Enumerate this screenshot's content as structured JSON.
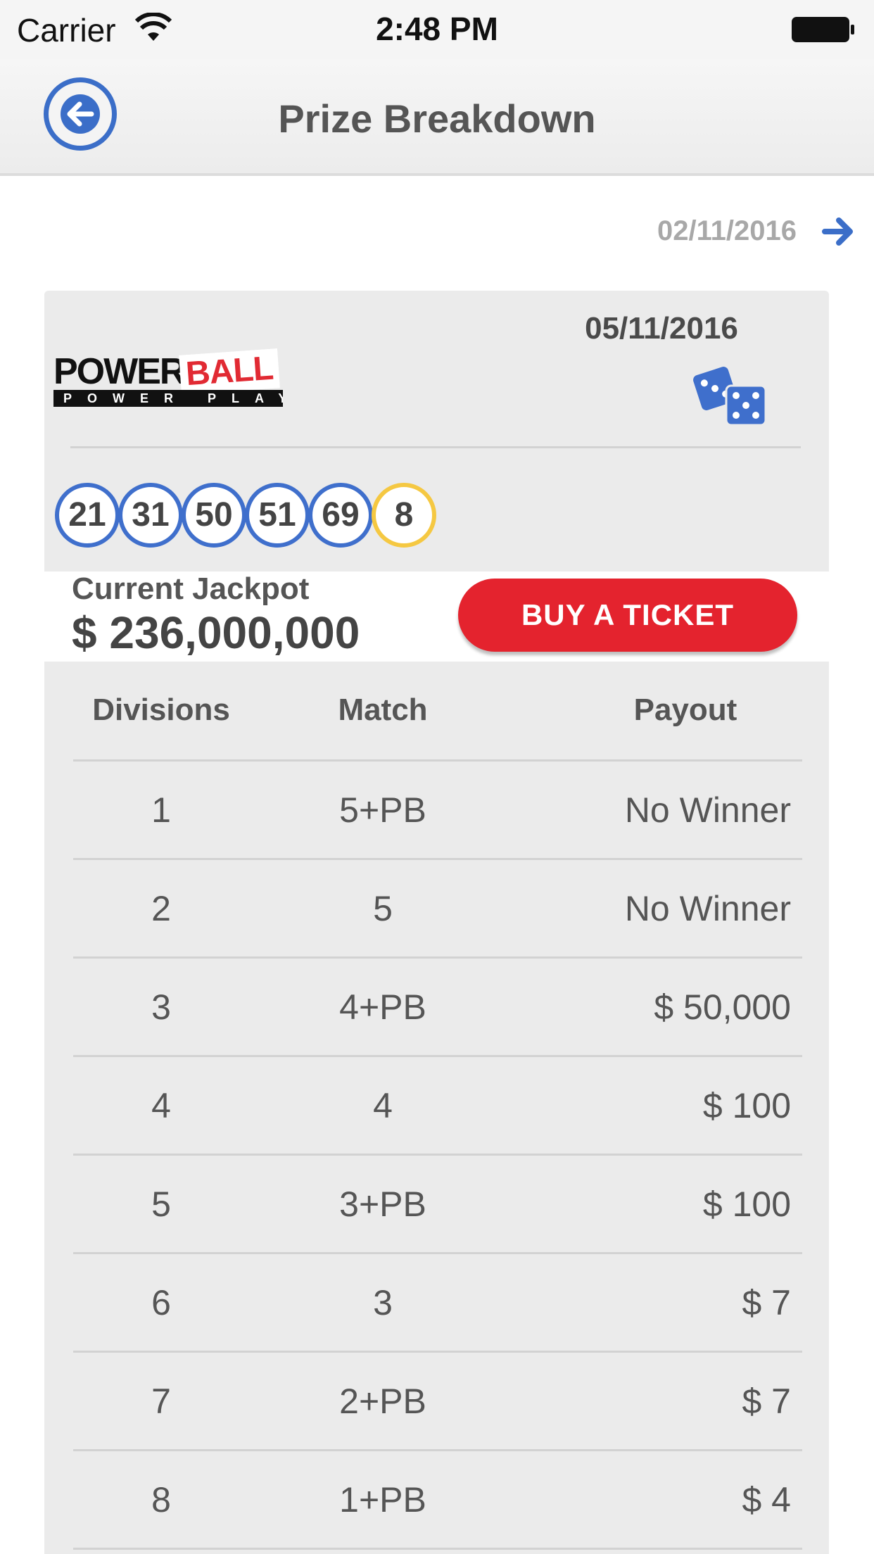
{
  "status_bar": {
    "carrier": "Carrier",
    "time": "2:48 PM"
  },
  "nav": {
    "title": "Prize Breakdown",
    "back_icon": "back-arrow-circle-icon"
  },
  "next_draw": {
    "date": "02/11/2016",
    "icon": "arrow-right-icon"
  },
  "draw": {
    "logo_main": "POWER",
    "logo_accent": "BALL",
    "logo_sub": "POWER PLAY",
    "date": "05/11/2016",
    "dice_icon": "dice-icon",
    "balls": [
      "21",
      "31",
      "50",
      "51",
      "69"
    ],
    "powerball": "8"
  },
  "jackpot": {
    "label": "Current Jackpot",
    "amount": "$ 236,000,000"
  },
  "buy_button": {
    "label": "BUY A TICKET"
  },
  "table": {
    "headers": {
      "division": "Divisions",
      "match": "Match",
      "payout": "Payout"
    },
    "rows": [
      {
        "division": "1",
        "match": "5+PB",
        "payout": "No Winner"
      },
      {
        "division": "2",
        "match": "5",
        "payout": "No Winner"
      },
      {
        "division": "3",
        "match": "4+PB",
        "payout": "$ 50,000"
      },
      {
        "division": "4",
        "match": "4",
        "payout": "$ 100"
      },
      {
        "division": "5",
        "match": "3+PB",
        "payout": "$ 100"
      },
      {
        "division": "6",
        "match": "3",
        "payout": "$ 7"
      },
      {
        "division": "7",
        "match": "2+PB",
        "payout": "$ 7"
      },
      {
        "division": "8",
        "match": "1+PB",
        "payout": "$ 4"
      }
    ]
  },
  "colors": {
    "accent_blue": "#3b6ec8",
    "buy_red": "#e4232e",
    "powerball_yellow": "#f5c842"
  }
}
